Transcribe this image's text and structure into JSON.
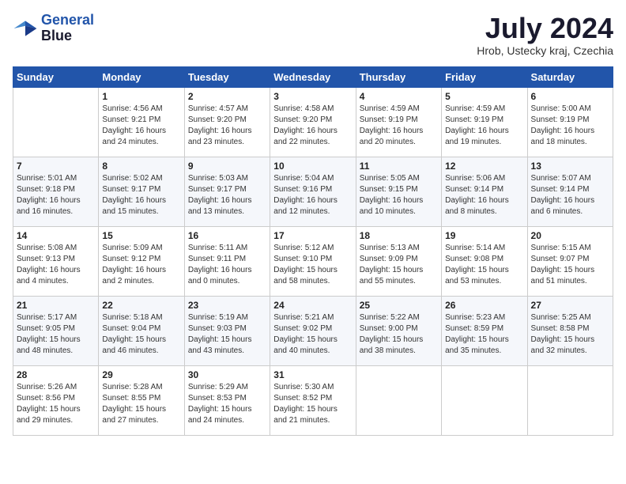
{
  "header": {
    "logo_line1": "General",
    "logo_line2": "Blue",
    "month": "July 2024",
    "location": "Hrob, Ustecky kraj, Czechia"
  },
  "days_of_week": [
    "Sunday",
    "Monday",
    "Tuesday",
    "Wednesday",
    "Thursday",
    "Friday",
    "Saturday"
  ],
  "weeks": [
    [
      {
        "day": "",
        "info": ""
      },
      {
        "day": "1",
        "info": "Sunrise: 4:56 AM\nSunset: 9:21 PM\nDaylight: 16 hours\nand 24 minutes."
      },
      {
        "day": "2",
        "info": "Sunrise: 4:57 AM\nSunset: 9:20 PM\nDaylight: 16 hours\nand 23 minutes."
      },
      {
        "day": "3",
        "info": "Sunrise: 4:58 AM\nSunset: 9:20 PM\nDaylight: 16 hours\nand 22 minutes."
      },
      {
        "day": "4",
        "info": "Sunrise: 4:59 AM\nSunset: 9:19 PM\nDaylight: 16 hours\nand 20 minutes."
      },
      {
        "day": "5",
        "info": "Sunrise: 4:59 AM\nSunset: 9:19 PM\nDaylight: 16 hours\nand 19 minutes."
      },
      {
        "day": "6",
        "info": "Sunrise: 5:00 AM\nSunset: 9:19 PM\nDaylight: 16 hours\nand 18 minutes."
      }
    ],
    [
      {
        "day": "7",
        "info": "Sunrise: 5:01 AM\nSunset: 9:18 PM\nDaylight: 16 hours\nand 16 minutes."
      },
      {
        "day": "8",
        "info": "Sunrise: 5:02 AM\nSunset: 9:17 PM\nDaylight: 16 hours\nand 15 minutes."
      },
      {
        "day": "9",
        "info": "Sunrise: 5:03 AM\nSunset: 9:17 PM\nDaylight: 16 hours\nand 13 minutes."
      },
      {
        "day": "10",
        "info": "Sunrise: 5:04 AM\nSunset: 9:16 PM\nDaylight: 16 hours\nand 12 minutes."
      },
      {
        "day": "11",
        "info": "Sunrise: 5:05 AM\nSunset: 9:15 PM\nDaylight: 16 hours\nand 10 minutes."
      },
      {
        "day": "12",
        "info": "Sunrise: 5:06 AM\nSunset: 9:14 PM\nDaylight: 16 hours\nand 8 minutes."
      },
      {
        "day": "13",
        "info": "Sunrise: 5:07 AM\nSunset: 9:14 PM\nDaylight: 16 hours\nand 6 minutes."
      }
    ],
    [
      {
        "day": "14",
        "info": "Sunrise: 5:08 AM\nSunset: 9:13 PM\nDaylight: 16 hours\nand 4 minutes."
      },
      {
        "day": "15",
        "info": "Sunrise: 5:09 AM\nSunset: 9:12 PM\nDaylight: 16 hours\nand 2 minutes."
      },
      {
        "day": "16",
        "info": "Sunrise: 5:11 AM\nSunset: 9:11 PM\nDaylight: 16 hours\nand 0 minutes."
      },
      {
        "day": "17",
        "info": "Sunrise: 5:12 AM\nSunset: 9:10 PM\nDaylight: 15 hours\nand 58 minutes."
      },
      {
        "day": "18",
        "info": "Sunrise: 5:13 AM\nSunset: 9:09 PM\nDaylight: 15 hours\nand 55 minutes."
      },
      {
        "day": "19",
        "info": "Sunrise: 5:14 AM\nSunset: 9:08 PM\nDaylight: 15 hours\nand 53 minutes."
      },
      {
        "day": "20",
        "info": "Sunrise: 5:15 AM\nSunset: 9:07 PM\nDaylight: 15 hours\nand 51 minutes."
      }
    ],
    [
      {
        "day": "21",
        "info": "Sunrise: 5:17 AM\nSunset: 9:05 PM\nDaylight: 15 hours\nand 48 minutes."
      },
      {
        "day": "22",
        "info": "Sunrise: 5:18 AM\nSunset: 9:04 PM\nDaylight: 15 hours\nand 46 minutes."
      },
      {
        "day": "23",
        "info": "Sunrise: 5:19 AM\nSunset: 9:03 PM\nDaylight: 15 hours\nand 43 minutes."
      },
      {
        "day": "24",
        "info": "Sunrise: 5:21 AM\nSunset: 9:02 PM\nDaylight: 15 hours\nand 40 minutes."
      },
      {
        "day": "25",
        "info": "Sunrise: 5:22 AM\nSunset: 9:00 PM\nDaylight: 15 hours\nand 38 minutes."
      },
      {
        "day": "26",
        "info": "Sunrise: 5:23 AM\nSunset: 8:59 PM\nDaylight: 15 hours\nand 35 minutes."
      },
      {
        "day": "27",
        "info": "Sunrise: 5:25 AM\nSunset: 8:58 PM\nDaylight: 15 hours\nand 32 minutes."
      }
    ],
    [
      {
        "day": "28",
        "info": "Sunrise: 5:26 AM\nSunset: 8:56 PM\nDaylight: 15 hours\nand 29 minutes."
      },
      {
        "day": "29",
        "info": "Sunrise: 5:28 AM\nSunset: 8:55 PM\nDaylight: 15 hours\nand 27 minutes."
      },
      {
        "day": "30",
        "info": "Sunrise: 5:29 AM\nSunset: 8:53 PM\nDaylight: 15 hours\nand 24 minutes."
      },
      {
        "day": "31",
        "info": "Sunrise: 5:30 AM\nSunset: 8:52 PM\nDaylight: 15 hours\nand 21 minutes."
      },
      {
        "day": "",
        "info": ""
      },
      {
        "day": "",
        "info": ""
      },
      {
        "day": "",
        "info": ""
      }
    ]
  ]
}
